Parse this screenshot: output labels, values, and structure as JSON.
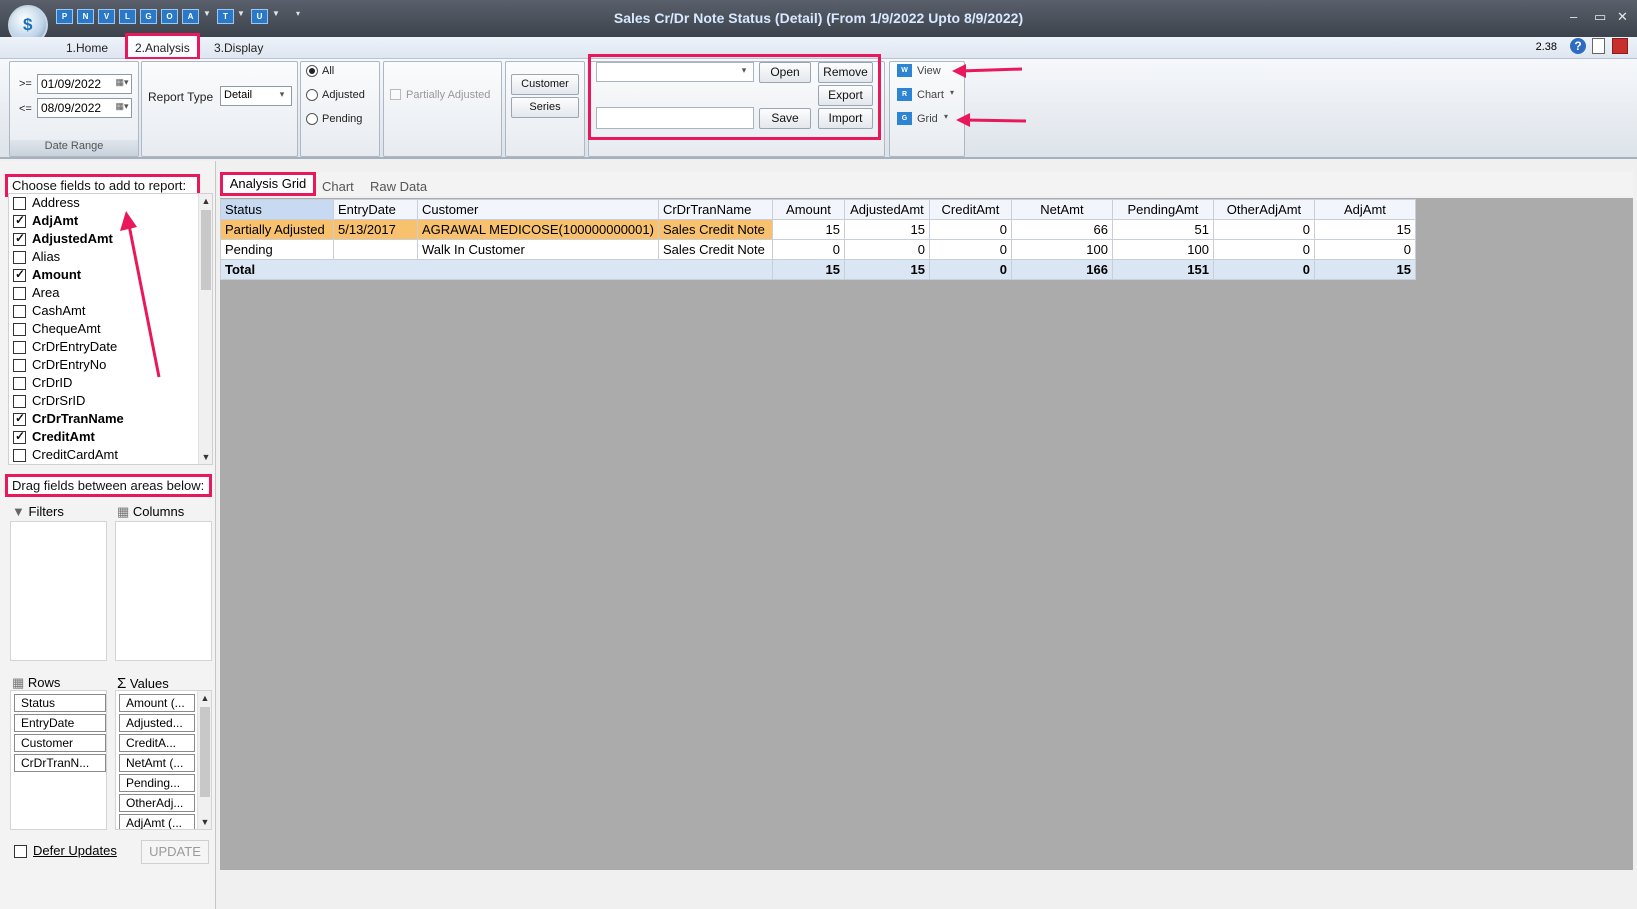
{
  "window": {
    "title": "Sales Cr/Dr Note Status (Detail)  (From 1/9/2022 Upto 8/9/2022)",
    "version": "2.38",
    "quick_access": [
      "P",
      "N",
      "V",
      "L",
      "G",
      "O",
      "A",
      "T",
      "U"
    ]
  },
  "ribbon_tabs": [
    "1.Home",
    "2.Analysis",
    "3.Display"
  ],
  "ribbon": {
    "date_range": {
      "from_op": ">=",
      "from_value": "01/09/2022",
      "to_op": "<=",
      "to_value": "08/09/2022",
      "caption": "Date Range"
    },
    "report_type": {
      "label": "Report Type",
      "value": "Detail"
    },
    "status_options": [
      {
        "label": "All",
        "selected": true
      },
      {
        "label": "Adjusted",
        "selected": false
      },
      {
        "label": "Pending",
        "selected": false
      }
    ],
    "partially_adjusted_label": "Partially Adjusted",
    "customer_button": "Customer",
    "series_button": "Series",
    "layout": {
      "open": "Open",
      "remove": "Remove",
      "export": "Export",
      "save": "Save",
      "import": "Import"
    },
    "view_group": {
      "view": "View",
      "chart": "Chart",
      "grid": "Grid"
    }
  },
  "field_list": {
    "header": "Choose fields to add to report:",
    "fields": [
      {
        "name": "Address",
        "checked": false
      },
      {
        "name": "AdjAmt",
        "checked": true
      },
      {
        "name": "AdjustedAmt",
        "checked": true
      },
      {
        "name": "Alias",
        "checked": false
      },
      {
        "name": "Amount",
        "checked": true
      },
      {
        "name": "Area",
        "checked": false
      },
      {
        "name": "CashAmt",
        "checked": false
      },
      {
        "name": "ChequeAmt",
        "checked": false
      },
      {
        "name": "CrDrEntryDate",
        "checked": false
      },
      {
        "name": "CrDrEntryNo",
        "checked": false
      },
      {
        "name": "CrDrID",
        "checked": false
      },
      {
        "name": "CrDrSrID",
        "checked": false
      },
      {
        "name": "CrDrTranName",
        "checked": true
      },
      {
        "name": "CreditAmt",
        "checked": true
      },
      {
        "name": "CreditCardAmt",
        "checked": false
      }
    ]
  },
  "areas": {
    "header": "Drag fields between areas below:",
    "filters_label": "Filters",
    "columns_label": "Columns",
    "rows_label": "Rows",
    "values_label": "Values",
    "rows": [
      "Status",
      "EntryDate",
      "Customer",
      "CrDrTranN..."
    ],
    "values": [
      "Amount (...",
      "Adjusted...",
      "CreditA...",
      "NetAmt (...",
      "Pending...",
      "OtherAdj...",
      "AdjAmt (..."
    ],
    "defer_label": "Defer Updates",
    "update_button": "UPDATE"
  },
  "grid_tabs": [
    "Analysis Grid",
    "Chart",
    "Raw Data"
  ],
  "pivot": {
    "columns": [
      "Status",
      "EntryDate",
      "Customer",
      "CrDrTranName",
      "Amount",
      "AdjustedAmt",
      "CreditAmt",
      "NetAmt",
      "PendingAmt",
      "OtherAdjAmt",
      "AdjAmt"
    ],
    "rows": [
      [
        "Partially Adjusted",
        "5/13/2017",
        "AGRAWAL MEDICOSE(100000000001)",
        "Sales Credit Note",
        "15",
        "15",
        "0",
        "66",
        "51",
        "0",
        "15"
      ],
      [
        "Pending",
        "",
        "Walk In Customer",
        "Sales Credit Note",
        "0",
        "0",
        "0",
        "100",
        "100",
        "0",
        "0"
      ]
    ],
    "total_label": "Total",
    "totals": [
      "15",
      "15",
      "0",
      "166",
      "151",
      "0",
      "15"
    ]
  },
  "colors": {
    "highlight_box": "#e8185a",
    "selected_row": "#f7c16e",
    "status_header": "#c7daf2"
  }
}
